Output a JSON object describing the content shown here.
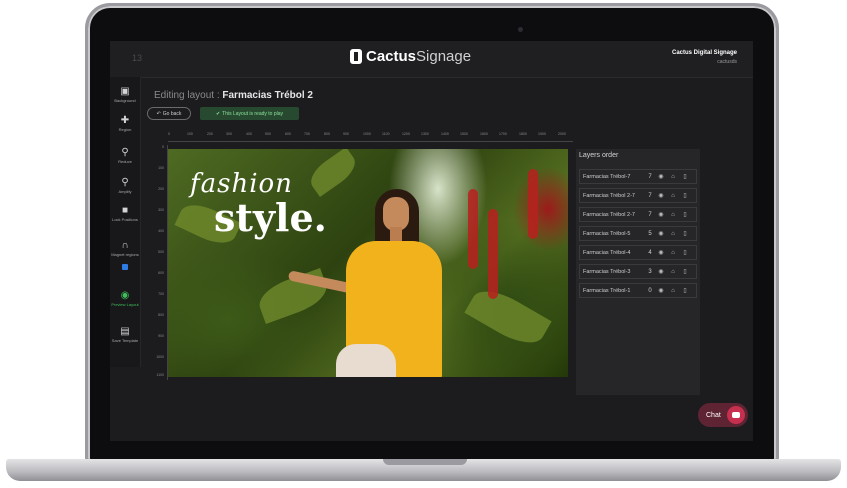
{
  "header": {
    "corner_number": "13",
    "brand_bold": "Cactus",
    "brand_light": "Signage",
    "account_name": "Cactus Digital Signage",
    "account_user": "cactusds"
  },
  "sidebar": {
    "items": [
      {
        "icon": "image-icon",
        "label": "Background"
      },
      {
        "icon": "plus-icon",
        "label": "Region"
      },
      {
        "icon": "zoom-out-icon",
        "label": "Reduce"
      },
      {
        "icon": "zoom-in-icon",
        "label": "Amplify"
      },
      {
        "icon": "lock-icon",
        "label": "Lock Positions"
      },
      {
        "icon": "magnet-icon",
        "label": "Magnet regions"
      },
      {
        "icon": "eye-icon",
        "label": "Preview Layout"
      },
      {
        "icon": "save-icon",
        "label": "Save Template"
      }
    ]
  },
  "editing": {
    "prefix": "Editing layout :",
    "layout_name": "Farmacias Trébol 2"
  },
  "actions": {
    "go_back": "Go back",
    "ready": "This Layout is ready to play"
  },
  "ruler": {
    "top": [
      "0",
      "100",
      "200",
      "300",
      "400",
      "500",
      "600",
      "700",
      "800",
      "900",
      "1000",
      "1100",
      "1200",
      "1300",
      "1400",
      "1500",
      "1600",
      "1700",
      "1800",
      "1900",
      "2000"
    ],
    "left": [
      "0",
      "100",
      "200",
      "300",
      "400",
      "500",
      "600",
      "700",
      "800",
      "900",
      "1000",
      "1100"
    ]
  },
  "canvas_text": {
    "line1": "fashion",
    "line2": "style."
  },
  "layers": {
    "title": "Layers order",
    "rows": [
      {
        "name": "Farmacias Trébol-7",
        "order": "7"
      },
      {
        "name": "Farmacias Trébol 2-7",
        "order": "7"
      },
      {
        "name": "Farmacias Trébol 2-7",
        "order": "7"
      },
      {
        "name": "Farmacias Trébol-5",
        "order": "5"
      },
      {
        "name": "Farmacias Trébol-4",
        "order": "4"
      },
      {
        "name": "Farmacias Trébol-3",
        "order": "3"
      },
      {
        "name": "Farmacias Trébol-1",
        "order": "0"
      }
    ]
  },
  "chat": {
    "label": "Chat"
  },
  "colors": {
    "accent_green": "#3fbf5a",
    "chat_pink": "#c62f4e",
    "dress_yellow": "#f2b21b"
  }
}
